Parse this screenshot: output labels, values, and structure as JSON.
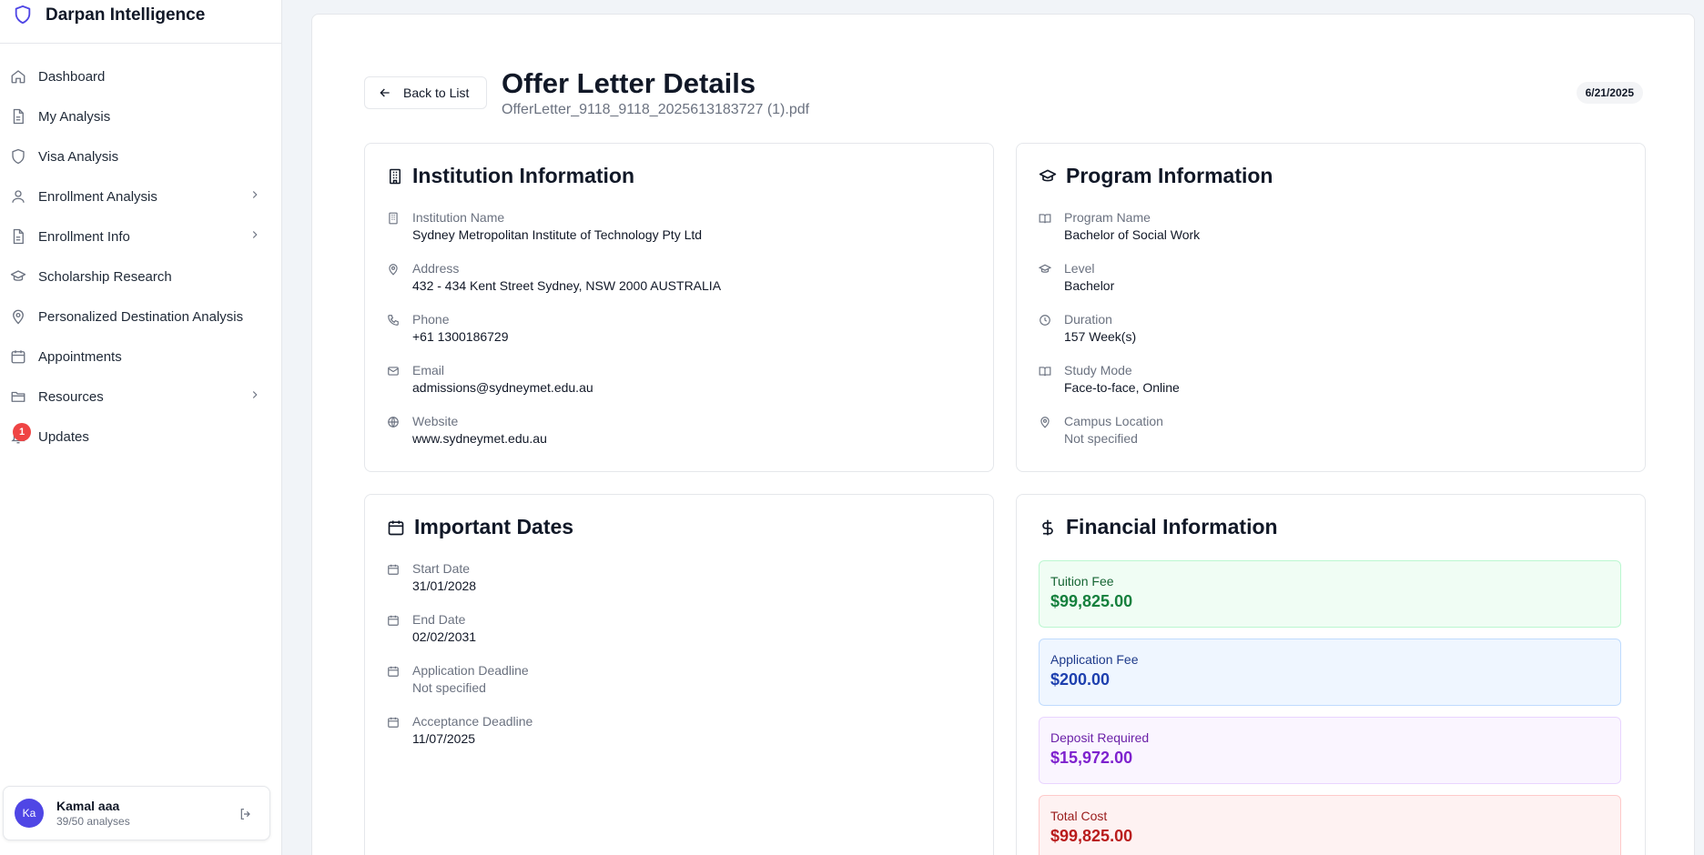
{
  "app": {
    "title": "Darpan Intelligence"
  },
  "sidebar": {
    "items": [
      {
        "label": "Dashboard"
      },
      {
        "label": "My Analysis"
      },
      {
        "label": "Visa Analysis"
      },
      {
        "label": "Enrollment Analysis"
      },
      {
        "label": "Enrollment Info"
      },
      {
        "label": "Scholarship Research"
      },
      {
        "label": "Personalized Destination Analysis"
      },
      {
        "label": "Appointments"
      },
      {
        "label": "Resources"
      },
      {
        "label": "Updates",
        "badge": "1"
      }
    ],
    "user": {
      "initials": "Ka",
      "name": "Kamal aaa",
      "usage": "39/50 analyses"
    }
  },
  "header": {
    "back_label": "Back to List",
    "title": "Offer Letter Details",
    "file_name": "OfferLetter_9118_9118_2025613183727 (1).pdf",
    "date": "6/21/2025"
  },
  "institution": {
    "title": "Institution Information",
    "fields": [
      {
        "label": "Institution Name",
        "value": "Sydney Metropolitan Institute of Technology Pty Ltd"
      },
      {
        "label": "Address",
        "value": "432 - 434 Kent Street Sydney, NSW 2000 AUSTRALIA"
      },
      {
        "label": "Phone",
        "value": "+61 1300186729"
      },
      {
        "label": "Email",
        "value": "admissions@sydneymet.edu.au"
      },
      {
        "label": "Website",
        "value": "www.sydneymet.edu.au"
      }
    ]
  },
  "program": {
    "title": "Program Information",
    "fields": [
      {
        "label": "Program Name",
        "value": "Bachelor of Social Work"
      },
      {
        "label": "Level",
        "value": "Bachelor"
      },
      {
        "label": "Duration",
        "value": "157 Week(s)"
      },
      {
        "label": "Study Mode",
        "value": "Face-to-face, Online"
      },
      {
        "label": "Campus Location",
        "value": "Not specified"
      }
    ]
  },
  "dates": {
    "title": "Important Dates",
    "fields": [
      {
        "label": "Start Date",
        "value": "31/01/2028"
      },
      {
        "label": "End Date",
        "value": "02/02/2031"
      },
      {
        "label": "Application Deadline",
        "value": "Not specified"
      },
      {
        "label": "Acceptance Deadline",
        "value": "11/07/2025"
      }
    ]
  },
  "financial": {
    "title": "Financial Information",
    "items": [
      {
        "label": "Tuition Fee",
        "value": "$99,825.00"
      },
      {
        "label": "Application Fee",
        "value": "$200.00"
      },
      {
        "label": "Deposit Required",
        "value": "$15,972.00"
      },
      {
        "label": "Total Cost",
        "value": "$99,825.00"
      }
    ]
  }
}
